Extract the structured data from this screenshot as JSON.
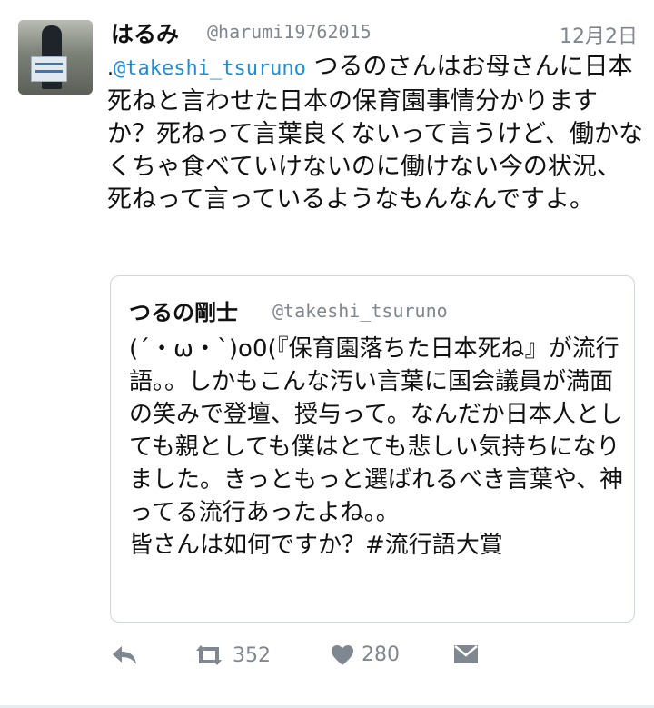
{
  "tweet": {
    "display_name": "はるみ",
    "handle": "@harumi19762015",
    "date": "12月2日",
    "leading_dot": ".",
    "mention": "@takeshi_tsuruno",
    "text": " つるのさんはお母さんに日本死ねと言わせた日本の保育園事情分かりますか？死ねって言葉良くないって言うけど、働かなくちゃ食べていけないのに働けない今の状況、死ねって言っているようなもんなんですよ。"
  },
  "quoted": {
    "display_name": "つるの剛士",
    "handle": "@takeshi_tsuruno",
    "text": "(´・ω・`)o0(『保育園落ちた日本死ね』が流行語。。しかもこんな汚い言葉に国会議員が満面の笑みで登壇、授与って。なんだか日本人としても親としても僕はとても悲しい気持ちになりました。きっともっと選ばれるべき言葉や、神ってる流行あったよね。。\n皆さんは如何ですか？#流行語大賞"
  },
  "actions": {
    "reply_icon": "reply-icon",
    "retweet_icon": "retweet-icon",
    "retweet_count": "352",
    "like_icon": "heart-icon",
    "like_count": "280",
    "dm_icon": "direct-message-icon"
  },
  "colors": {
    "link": "#1f8ed8",
    "muted": "#7f8790",
    "border": "#cfd5db"
  }
}
